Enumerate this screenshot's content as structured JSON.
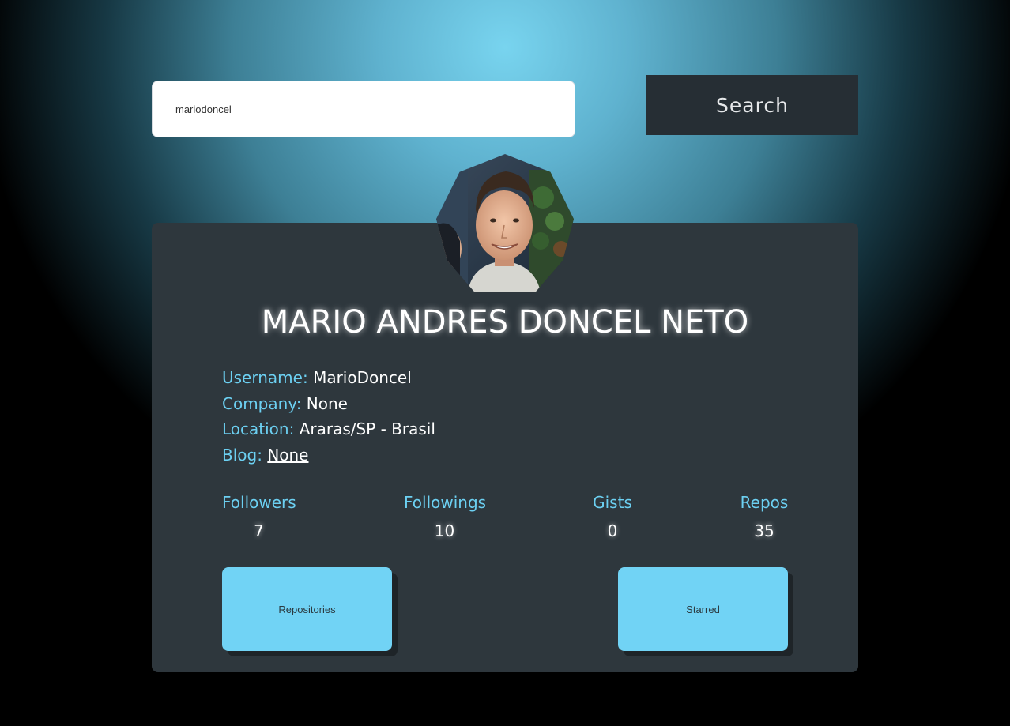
{
  "search": {
    "value": "mariodoncel",
    "button_label": "Search"
  },
  "profile": {
    "name": "MARIO ANDRES DONCEL NETO",
    "avatar_icon": "user-photo",
    "details": [
      {
        "label": "Username:",
        "value": "MarioDoncel"
      },
      {
        "label": "Company:",
        "value": "None"
      },
      {
        "label": "Location:",
        "value": "Araras/SP - Brasil"
      },
      {
        "label": "Blog:",
        "value": "None"
      }
    ],
    "stats": [
      {
        "label": "Followers",
        "value": "7"
      },
      {
        "label": "Followings",
        "value": "10"
      },
      {
        "label": "Gists",
        "value": "0"
      },
      {
        "label": "Repos",
        "value": "35"
      }
    ]
  },
  "actions": {
    "repositories_label": "Repositories",
    "starred_label": "Starred"
  },
  "colors": {
    "accent": "#71d3f5",
    "label": "#6cd0f2",
    "card": "#2e373d",
    "button_dark": "#262e34"
  }
}
